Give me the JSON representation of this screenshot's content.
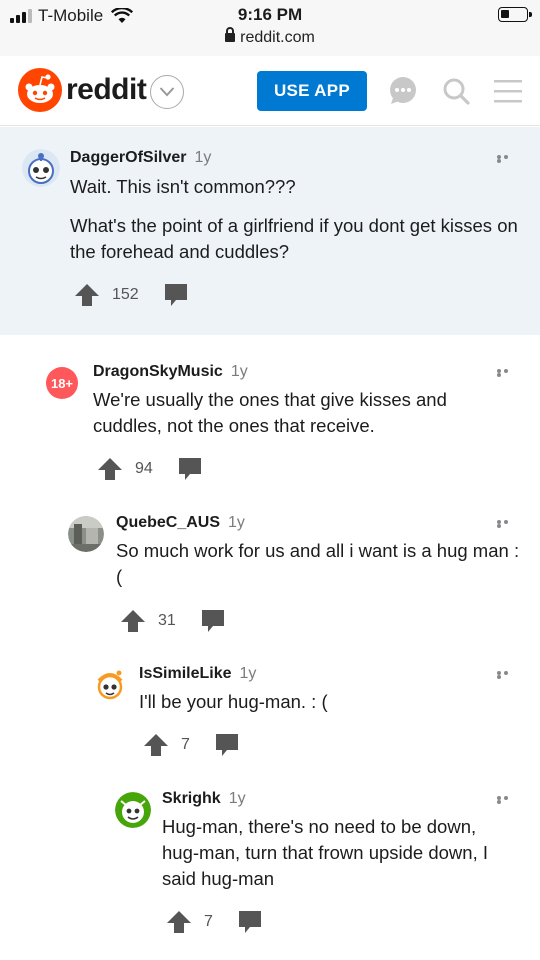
{
  "status_bar": {
    "carrier": "T-Mobile",
    "time": "9:16 PM",
    "url": "reddit.com"
  },
  "header": {
    "logo_text": "reddit",
    "use_app_label": "USE APP",
    "icons": [
      "reddit-logo-icon",
      "chevron-down-icon",
      "chat-icon",
      "search-icon",
      "menu-icon"
    ]
  },
  "colors": {
    "accent": "#0079d3",
    "reddit_orange": "#ff4500",
    "highlight_bg": "#eef3f8",
    "nsfw_badge": "#ff585b"
  },
  "comments": [
    {
      "author": "DaggerOfSilver",
      "age": "1y",
      "paragraphs": [
        "Wait. This isn't common???",
        "What's the point of a girlfriend if you dont get kisses on the forehead and cuddles?"
      ],
      "score": "152"
    },
    {
      "author": "DragonSkyMusic",
      "age": "1y",
      "badge": "18+",
      "paragraphs": [
        "We're usually the ones that give kisses and cuddles, not the ones that receive."
      ],
      "score": "94"
    },
    {
      "author": "QuebeC_AUS",
      "age": "1y",
      "paragraphs": [
        "So much work for us and all i want is a hug man :("
      ],
      "score": "31"
    },
    {
      "author": "IsSimileLike",
      "age": "1y",
      "paragraphs": [
        "I'll be your hug-man. : ("
      ],
      "score": "7"
    },
    {
      "author": "Skrighk",
      "age": "1y",
      "paragraphs": [
        "Hug-man, there's no need to be down, hug-man, turn that frown upside down, I said hug-man"
      ],
      "score": "7"
    }
  ]
}
